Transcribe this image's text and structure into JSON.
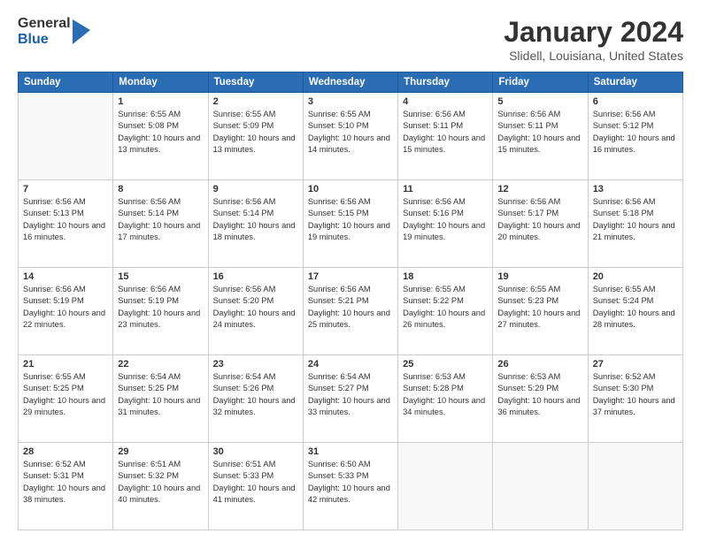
{
  "logo": {
    "general": "General",
    "blue": "Blue"
  },
  "header": {
    "title": "January 2024",
    "subtitle": "Slidell, Louisiana, United States"
  },
  "calendar": {
    "days_of_week": [
      "Sunday",
      "Monday",
      "Tuesday",
      "Wednesday",
      "Thursday",
      "Friday",
      "Saturday"
    ],
    "weeks": [
      [
        {
          "day": "",
          "sunrise": "",
          "sunset": "",
          "daylight": "",
          "empty": true
        },
        {
          "day": "1",
          "sunrise": "Sunrise: 6:55 AM",
          "sunset": "Sunset: 5:08 PM",
          "daylight": "Daylight: 10 hours and 13 minutes.",
          "empty": false
        },
        {
          "day": "2",
          "sunrise": "Sunrise: 6:55 AM",
          "sunset": "Sunset: 5:09 PM",
          "daylight": "Daylight: 10 hours and 13 minutes.",
          "empty": false
        },
        {
          "day": "3",
          "sunrise": "Sunrise: 6:55 AM",
          "sunset": "Sunset: 5:10 PM",
          "daylight": "Daylight: 10 hours and 14 minutes.",
          "empty": false
        },
        {
          "day": "4",
          "sunrise": "Sunrise: 6:56 AM",
          "sunset": "Sunset: 5:11 PM",
          "daylight": "Daylight: 10 hours and 15 minutes.",
          "empty": false
        },
        {
          "day": "5",
          "sunrise": "Sunrise: 6:56 AM",
          "sunset": "Sunset: 5:11 PM",
          "daylight": "Daylight: 10 hours and 15 minutes.",
          "empty": false
        },
        {
          "day": "6",
          "sunrise": "Sunrise: 6:56 AM",
          "sunset": "Sunset: 5:12 PM",
          "daylight": "Daylight: 10 hours and 16 minutes.",
          "empty": false
        }
      ],
      [
        {
          "day": "7",
          "sunrise": "Sunrise: 6:56 AM",
          "sunset": "Sunset: 5:13 PM",
          "daylight": "Daylight: 10 hours and 16 minutes.",
          "empty": false
        },
        {
          "day": "8",
          "sunrise": "Sunrise: 6:56 AM",
          "sunset": "Sunset: 5:14 PM",
          "daylight": "Daylight: 10 hours and 17 minutes.",
          "empty": false
        },
        {
          "day": "9",
          "sunrise": "Sunrise: 6:56 AM",
          "sunset": "Sunset: 5:14 PM",
          "daylight": "Daylight: 10 hours and 18 minutes.",
          "empty": false
        },
        {
          "day": "10",
          "sunrise": "Sunrise: 6:56 AM",
          "sunset": "Sunset: 5:15 PM",
          "daylight": "Daylight: 10 hours and 19 minutes.",
          "empty": false
        },
        {
          "day": "11",
          "sunrise": "Sunrise: 6:56 AM",
          "sunset": "Sunset: 5:16 PM",
          "daylight": "Daylight: 10 hours and 19 minutes.",
          "empty": false
        },
        {
          "day": "12",
          "sunrise": "Sunrise: 6:56 AM",
          "sunset": "Sunset: 5:17 PM",
          "daylight": "Daylight: 10 hours and 20 minutes.",
          "empty": false
        },
        {
          "day": "13",
          "sunrise": "Sunrise: 6:56 AM",
          "sunset": "Sunset: 5:18 PM",
          "daylight": "Daylight: 10 hours and 21 minutes.",
          "empty": false
        }
      ],
      [
        {
          "day": "14",
          "sunrise": "Sunrise: 6:56 AM",
          "sunset": "Sunset: 5:19 PM",
          "daylight": "Daylight: 10 hours and 22 minutes.",
          "empty": false
        },
        {
          "day": "15",
          "sunrise": "Sunrise: 6:56 AM",
          "sunset": "Sunset: 5:19 PM",
          "daylight": "Daylight: 10 hours and 23 minutes.",
          "empty": false
        },
        {
          "day": "16",
          "sunrise": "Sunrise: 6:56 AM",
          "sunset": "Sunset: 5:20 PM",
          "daylight": "Daylight: 10 hours and 24 minutes.",
          "empty": false
        },
        {
          "day": "17",
          "sunrise": "Sunrise: 6:56 AM",
          "sunset": "Sunset: 5:21 PM",
          "daylight": "Daylight: 10 hours and 25 minutes.",
          "empty": false
        },
        {
          "day": "18",
          "sunrise": "Sunrise: 6:55 AM",
          "sunset": "Sunset: 5:22 PM",
          "daylight": "Daylight: 10 hours and 26 minutes.",
          "empty": false
        },
        {
          "day": "19",
          "sunrise": "Sunrise: 6:55 AM",
          "sunset": "Sunset: 5:23 PM",
          "daylight": "Daylight: 10 hours and 27 minutes.",
          "empty": false
        },
        {
          "day": "20",
          "sunrise": "Sunrise: 6:55 AM",
          "sunset": "Sunset: 5:24 PM",
          "daylight": "Daylight: 10 hours and 28 minutes.",
          "empty": false
        }
      ],
      [
        {
          "day": "21",
          "sunrise": "Sunrise: 6:55 AM",
          "sunset": "Sunset: 5:25 PM",
          "daylight": "Daylight: 10 hours and 29 minutes.",
          "empty": false
        },
        {
          "day": "22",
          "sunrise": "Sunrise: 6:54 AM",
          "sunset": "Sunset: 5:25 PM",
          "daylight": "Daylight: 10 hours and 31 minutes.",
          "empty": false
        },
        {
          "day": "23",
          "sunrise": "Sunrise: 6:54 AM",
          "sunset": "Sunset: 5:26 PM",
          "daylight": "Daylight: 10 hours and 32 minutes.",
          "empty": false
        },
        {
          "day": "24",
          "sunrise": "Sunrise: 6:54 AM",
          "sunset": "Sunset: 5:27 PM",
          "daylight": "Daylight: 10 hours and 33 minutes.",
          "empty": false
        },
        {
          "day": "25",
          "sunrise": "Sunrise: 6:53 AM",
          "sunset": "Sunset: 5:28 PM",
          "daylight": "Daylight: 10 hours and 34 minutes.",
          "empty": false
        },
        {
          "day": "26",
          "sunrise": "Sunrise: 6:53 AM",
          "sunset": "Sunset: 5:29 PM",
          "daylight": "Daylight: 10 hours and 36 minutes.",
          "empty": false
        },
        {
          "day": "27",
          "sunrise": "Sunrise: 6:52 AM",
          "sunset": "Sunset: 5:30 PM",
          "daylight": "Daylight: 10 hours and 37 minutes.",
          "empty": false
        }
      ],
      [
        {
          "day": "28",
          "sunrise": "Sunrise: 6:52 AM",
          "sunset": "Sunset: 5:31 PM",
          "daylight": "Daylight: 10 hours and 38 minutes.",
          "empty": false
        },
        {
          "day": "29",
          "sunrise": "Sunrise: 6:51 AM",
          "sunset": "Sunset: 5:32 PM",
          "daylight": "Daylight: 10 hours and 40 minutes.",
          "empty": false
        },
        {
          "day": "30",
          "sunrise": "Sunrise: 6:51 AM",
          "sunset": "Sunset: 5:33 PM",
          "daylight": "Daylight: 10 hours and 41 minutes.",
          "empty": false
        },
        {
          "day": "31",
          "sunrise": "Sunrise: 6:50 AM",
          "sunset": "Sunset: 5:33 PM",
          "daylight": "Daylight: 10 hours and 42 minutes.",
          "empty": false
        },
        {
          "day": "",
          "sunrise": "",
          "sunset": "",
          "daylight": "",
          "empty": true
        },
        {
          "day": "",
          "sunrise": "",
          "sunset": "",
          "daylight": "",
          "empty": true
        },
        {
          "day": "",
          "sunrise": "",
          "sunset": "",
          "daylight": "",
          "empty": true
        }
      ]
    ]
  }
}
